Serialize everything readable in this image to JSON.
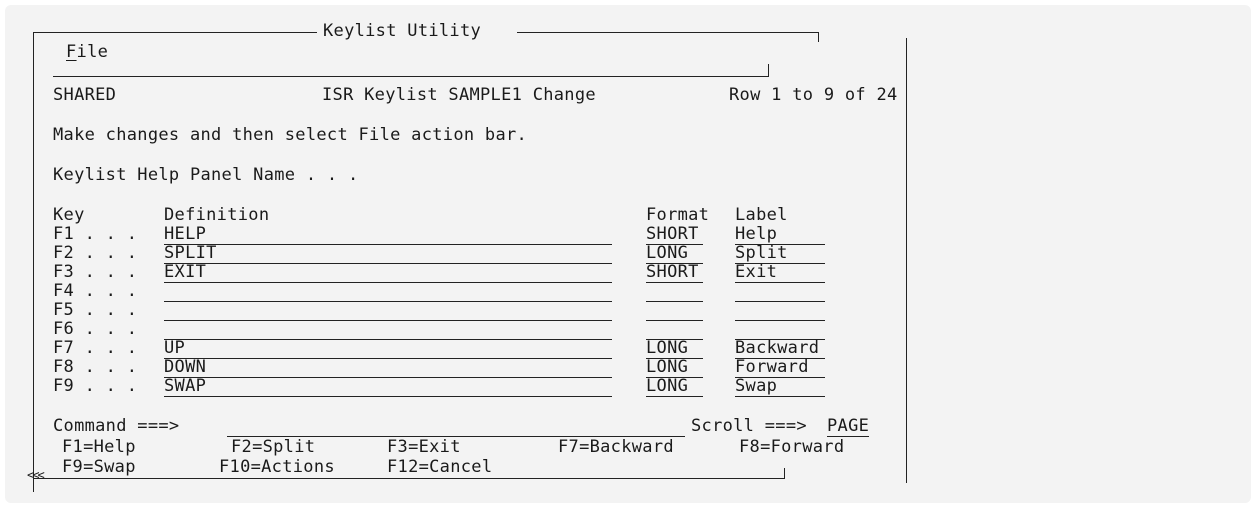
{
  "window": {
    "title": "Keylist Utility"
  },
  "menu": {
    "file_prefix": "F",
    "file_rest": "ile"
  },
  "header": {
    "left": "SHARED",
    "center": "ISR Keylist SAMPLE1 Change",
    "right": "Row 1 to 9 of 24"
  },
  "instruction": "Make changes and then select File action bar.",
  "help_panel_label": "Keylist Help Panel Name . . .",
  "columns": {
    "key": "Key",
    "definition": "Definition",
    "format": "Format",
    "label": "Label"
  },
  "rows": [
    {
      "key": "F1 . . .",
      "definition": "HELP",
      "format": "SHORT",
      "label": "Help"
    },
    {
      "key": "F2 . . .",
      "definition": "SPLIT",
      "format": "LONG",
      "label": "Split"
    },
    {
      "key": "F3 . . .",
      "definition": "EXIT",
      "format": "SHORT",
      "label": "Exit"
    },
    {
      "key": "F4 . . .",
      "definition": "",
      "format": "",
      "label": ""
    },
    {
      "key": "F5 . . .",
      "definition": "",
      "format": "",
      "label": ""
    },
    {
      "key": "F6 . . .",
      "definition": "",
      "format": "",
      "label": ""
    },
    {
      "key": "F7 . . .",
      "definition": "UP",
      "format": "LONG",
      "label": "Backward"
    },
    {
      "key": "F8 . . .",
      "definition": "DOWN",
      "format": "LONG",
      "label": "Forward"
    },
    {
      "key": "F9 . . .",
      "definition": "SWAP",
      "format": "LONG",
      "label": "Swap"
    }
  ],
  "command": {
    "label": "Command ===>",
    "value": "",
    "scroll_label": "Scroll ===>",
    "scroll_value": "PAGE"
  },
  "function_keys": [
    {
      "text": "F1=Help"
    },
    {
      "text": "F2=Split"
    },
    {
      "text": "F3=Exit"
    },
    {
      "text": "F7=Backward"
    },
    {
      "text": "F8=Forward"
    },
    {
      "text": "F9=Swap"
    },
    {
      "text": "F10=Actions"
    },
    {
      "text": "F12=Cancel"
    }
  ],
  "resize_marker": "<<<"
}
